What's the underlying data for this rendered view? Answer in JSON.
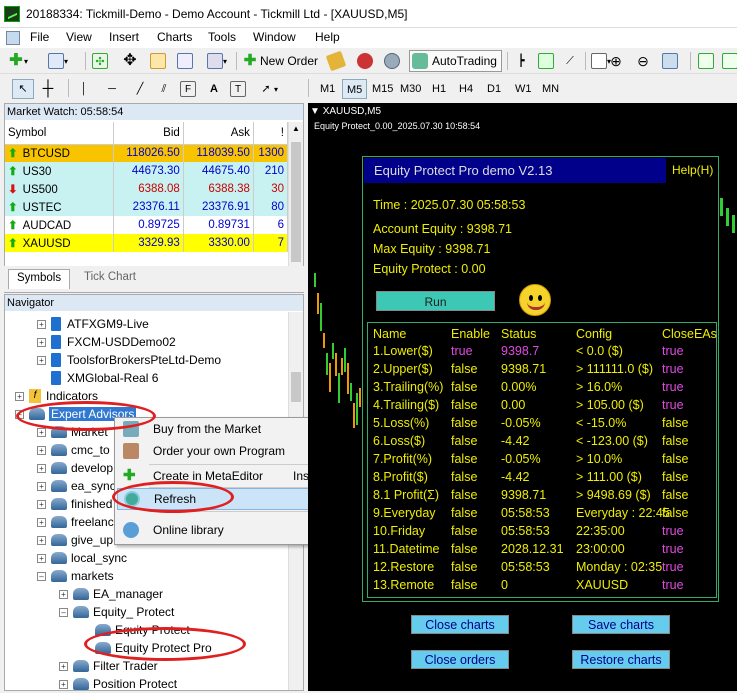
{
  "window": {
    "title": "20188334: Tickmill-Demo - Demo Account - Tickmill Ltd - [XAUUSD,M5]"
  },
  "menu": [
    "File",
    "View",
    "Insert",
    "Charts",
    "Tools",
    "Window",
    "Help"
  ],
  "toolbar": {
    "new_order": "New Order",
    "autotrading": "AutoTrading"
  },
  "timeframes": [
    "M1",
    "M5",
    "M15",
    "M30",
    "H1",
    "H4",
    "D1",
    "W1",
    "MN"
  ],
  "market_watch": {
    "header": "Market Watch: 05:58:54",
    "columns": [
      "Symbol",
      "Bid",
      "Ask",
      "!"
    ],
    "rows": [
      {
        "symbol": "BTCUSD",
        "bid": "118026.50",
        "ask": "118039.50",
        "spread": "1300",
        "bg": "#f8c400",
        "dir": "up"
      },
      {
        "symbol": "US30",
        "bid": "44673.30",
        "ask": "44675.40",
        "spread": "210",
        "bg": "#c8f2f2",
        "dir": "up"
      },
      {
        "symbol": "US500",
        "bid": "6388.08",
        "ask": "6388.38",
        "spread": "30",
        "bg": "#c8f2f2",
        "dir": "down"
      },
      {
        "symbol": "USTEC",
        "bid": "23376.11",
        "ask": "23376.91",
        "spread": "80",
        "bg": "#c8f2f2",
        "dir": "up"
      },
      {
        "symbol": "AUDCAD",
        "bid": "0.89725",
        "ask": "0.89731",
        "spread": "6",
        "bg": "#ffffff",
        "dir": "up"
      },
      {
        "symbol": "XAUUSD",
        "bid": "3329.93",
        "ask": "3330.00",
        "spread": "7",
        "bg": "#ffff00",
        "dir": "up"
      }
    ],
    "tabs": [
      "Symbols",
      "Tick Chart"
    ]
  },
  "navigator": {
    "header": "Navigator",
    "items": [
      "ATFXGM9-Live",
      "FXCM-USDDemo02",
      "ToolsforBrokersPteLtd-Demo",
      "XMGlobal-Real 6",
      "Indicators",
      "Expert Advisors",
      "Market",
      "cmc_to",
      "develop",
      "ea_sync",
      "finished",
      "freelanc",
      "give_up",
      "local_sync",
      "markets",
      "EA_manager",
      "Equity_ Protect",
      "Equity Protect",
      "Equity Protect Pro",
      "Filter Trader",
      "Position Protect"
    ]
  },
  "context_menu": {
    "items": [
      "Buy from the Market",
      "Order your own Program",
      "Create in MetaEditor",
      "Refresh",
      "Online library"
    ],
    "shortcut": "Insert"
  },
  "chart": {
    "tab": "XAUUSD,M5",
    "subtitle": "Equity Protect_0.00_2025.07.30 10:58:54"
  },
  "ea_panel": {
    "title": "Equity Protect Pro demo V2.13",
    "help": "Help(H)",
    "time": "Time : 2025.07.30 05:58:53",
    "account_equity": "Account Equity  : 9398.71",
    "max_equity": "Max Equity        : 9398.71",
    "equity_protect": "Equity Protect   : 0.00",
    "run": "Run",
    "columns": [
      "Name",
      "Enable",
      "Status",
      "Config",
      "CloseEAs"
    ],
    "rows": [
      [
        "1.Lower($)",
        "true",
        "9398.7",
        "< 0.0 ($)",
        "true"
      ],
      [
        "2.Upper($)",
        "false",
        "9398.71",
        "> 111111.0 ($)",
        "true"
      ],
      [
        "3.Trailing(%)",
        "false",
        "0.00%",
        "> 16.0%",
        "true"
      ],
      [
        "4.Trailing($)",
        "false",
        "0.00",
        "> 105.00 ($)",
        "true"
      ],
      [
        "5.Loss(%)",
        "false",
        "-0.05%",
        "< -15.0%",
        "false"
      ],
      [
        "6.Loss($)",
        "false",
        "-4.42",
        "< -123.00 ($)",
        "false"
      ],
      [
        "7.Profit(%)",
        "false",
        "-0.05%",
        "> 10.0%",
        "false"
      ],
      [
        "8.Profit($)",
        "false",
        "-4.42",
        "> 111.00 ($)",
        "false"
      ],
      [
        "8.1 Profit(Σ)",
        "false",
        "9398.71",
        "> 9498.69 ($)",
        "false"
      ],
      [
        "9.Everyday",
        "false",
        "05:58:53",
        "Everyday : 22:45",
        "false"
      ],
      [
        "10.Friday",
        "false",
        "05:58:53",
        "22:35:00",
        "true"
      ],
      [
        "11.Datetime",
        "false",
        "2028.12.31",
        "23:00:00",
        "true"
      ],
      [
        "12.Restore",
        "false",
        "05:58:53",
        "Monday : 02:35",
        "true"
      ],
      [
        "13.Remote",
        "false",
        "0",
        "XAUUSD",
        "true"
      ]
    ],
    "buttons": [
      "Close charts",
      "Save charts",
      "Close orders",
      "Restore charts"
    ]
  }
}
